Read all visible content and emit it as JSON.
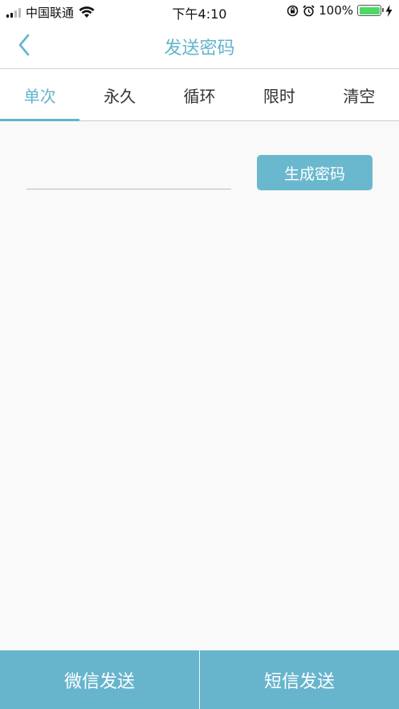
{
  "status_bar": {
    "carrier": "中国联通",
    "time": "下午4:10",
    "battery_percent": "100%",
    "battery_level": 1.0,
    "signal_bars_filled": 2,
    "signal_bars_total": 4
  },
  "nav": {
    "title": "发送密码",
    "back_icon": "chevron-left-icon"
  },
  "tabs": [
    {
      "label": "单次",
      "active": true
    },
    {
      "label": "永久",
      "active": false
    },
    {
      "label": "循环",
      "active": false
    },
    {
      "label": "限时",
      "active": false
    },
    {
      "label": "清空",
      "active": false
    }
  ],
  "form": {
    "password_value": "",
    "password_placeholder": "",
    "generate_label": "生成密码"
  },
  "bottom": {
    "wechat_label": "微信发送",
    "sms_label": "短信发送"
  },
  "colors": {
    "accent": "#63b5cc",
    "button": "#6ab8ce",
    "bottom_bar": "#67b5cd",
    "battery": "#4cd964"
  }
}
